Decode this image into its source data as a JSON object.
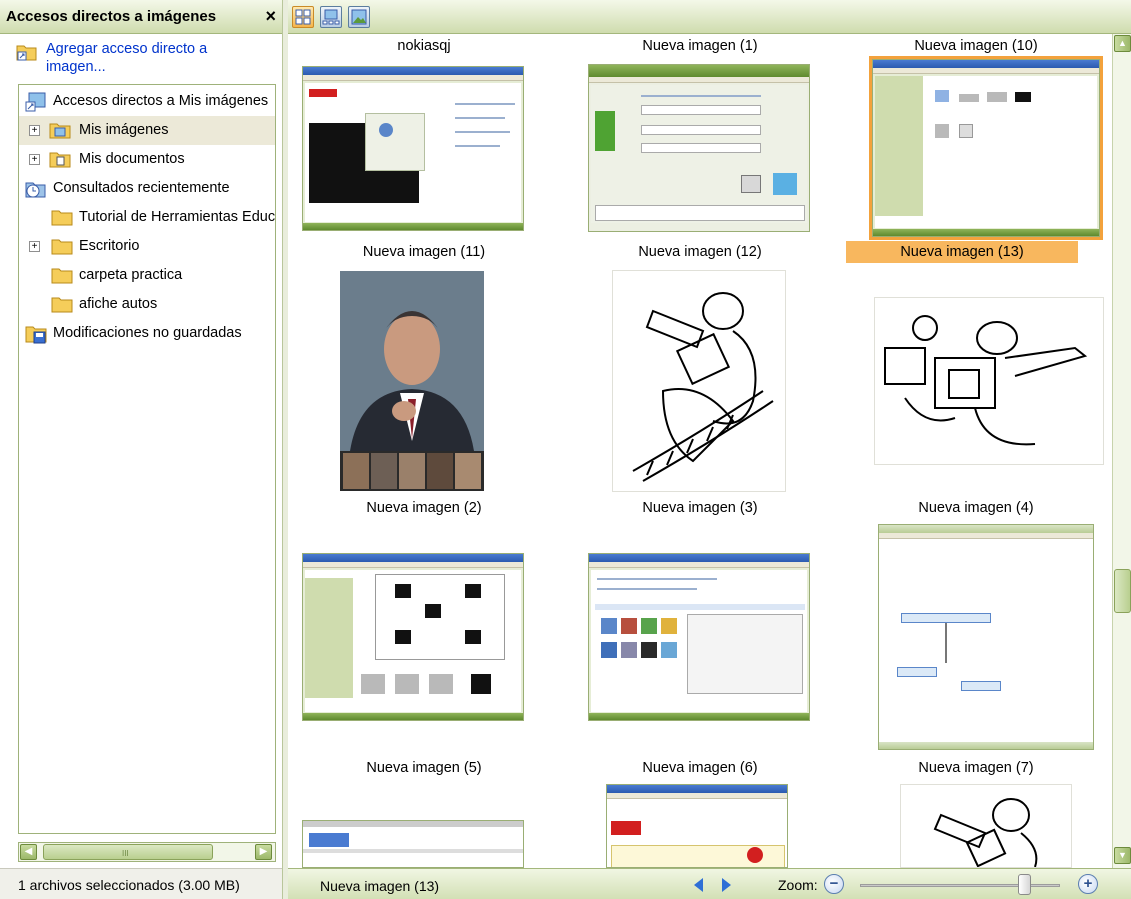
{
  "left_panel": {
    "title": "Accesos directos a imágenes",
    "close_glyph": "×",
    "add_shortcut_label": "Agregar acceso directo a imagen...",
    "tree": [
      {
        "label": "Accesos directos a Mis imágenes",
        "icon": "my-pictures-shortcut-icon",
        "expander": null,
        "selected": false
      },
      {
        "label": "Mis imágenes",
        "icon": "pictures-folder-icon",
        "expander": "+",
        "selected": true
      },
      {
        "label": "Mis documentos",
        "icon": "documents-folder-icon",
        "expander": "+",
        "selected": false
      },
      {
        "label": "Consultados recientemente",
        "icon": "recent-icon",
        "expander": null,
        "selected": false
      },
      {
        "label": "Tutorial de Herramientas Educ",
        "icon": "folder-icon",
        "expander": null,
        "selected": false
      },
      {
        "label": "Escritorio",
        "icon": "folder-icon",
        "expander": "+",
        "selected": false
      },
      {
        "label": "carpeta practica",
        "icon": "folder-icon",
        "expander": null,
        "selected": false
      },
      {
        "label": "afiche autos",
        "icon": "folder-icon",
        "expander": null,
        "selected": false
      },
      {
        "label": "Modificaciones no guardadas",
        "icon": "unsaved-changes-icon",
        "expander": null,
        "selected": false
      }
    ],
    "scroll_grip": "III",
    "status": "1 archivos seleccionados (3.00 MB)"
  },
  "toolbar": {
    "views": [
      "thumbnails-view-icon",
      "filmstrip-view-icon",
      "single-image-view-icon"
    ],
    "active_view": 0
  },
  "grid": {
    "captions": [
      "nokiasqj",
      "Nueva imagen (1)",
      "Nueva imagen (10)",
      "Nueva imagen (11)",
      "Nueva imagen (12)",
      "Nueva imagen (13)",
      "Nueva imagen (2)",
      "Nueva imagen (3)",
      "Nueva imagen (4)",
      "Nueva imagen (5)",
      "Nueva imagen (6)",
      "Nueva imagen (7)"
    ],
    "selected_index": 5,
    "highlighted_thumb_index": 2
  },
  "status_bar": {
    "current_image": "Nueva imagen (13)",
    "zoom_label": "Zoom:",
    "zoom_level": 0.82
  },
  "colors": {
    "selection": "#f8b75e",
    "link": "#0033cc",
    "header_green": "#cfdcae"
  }
}
